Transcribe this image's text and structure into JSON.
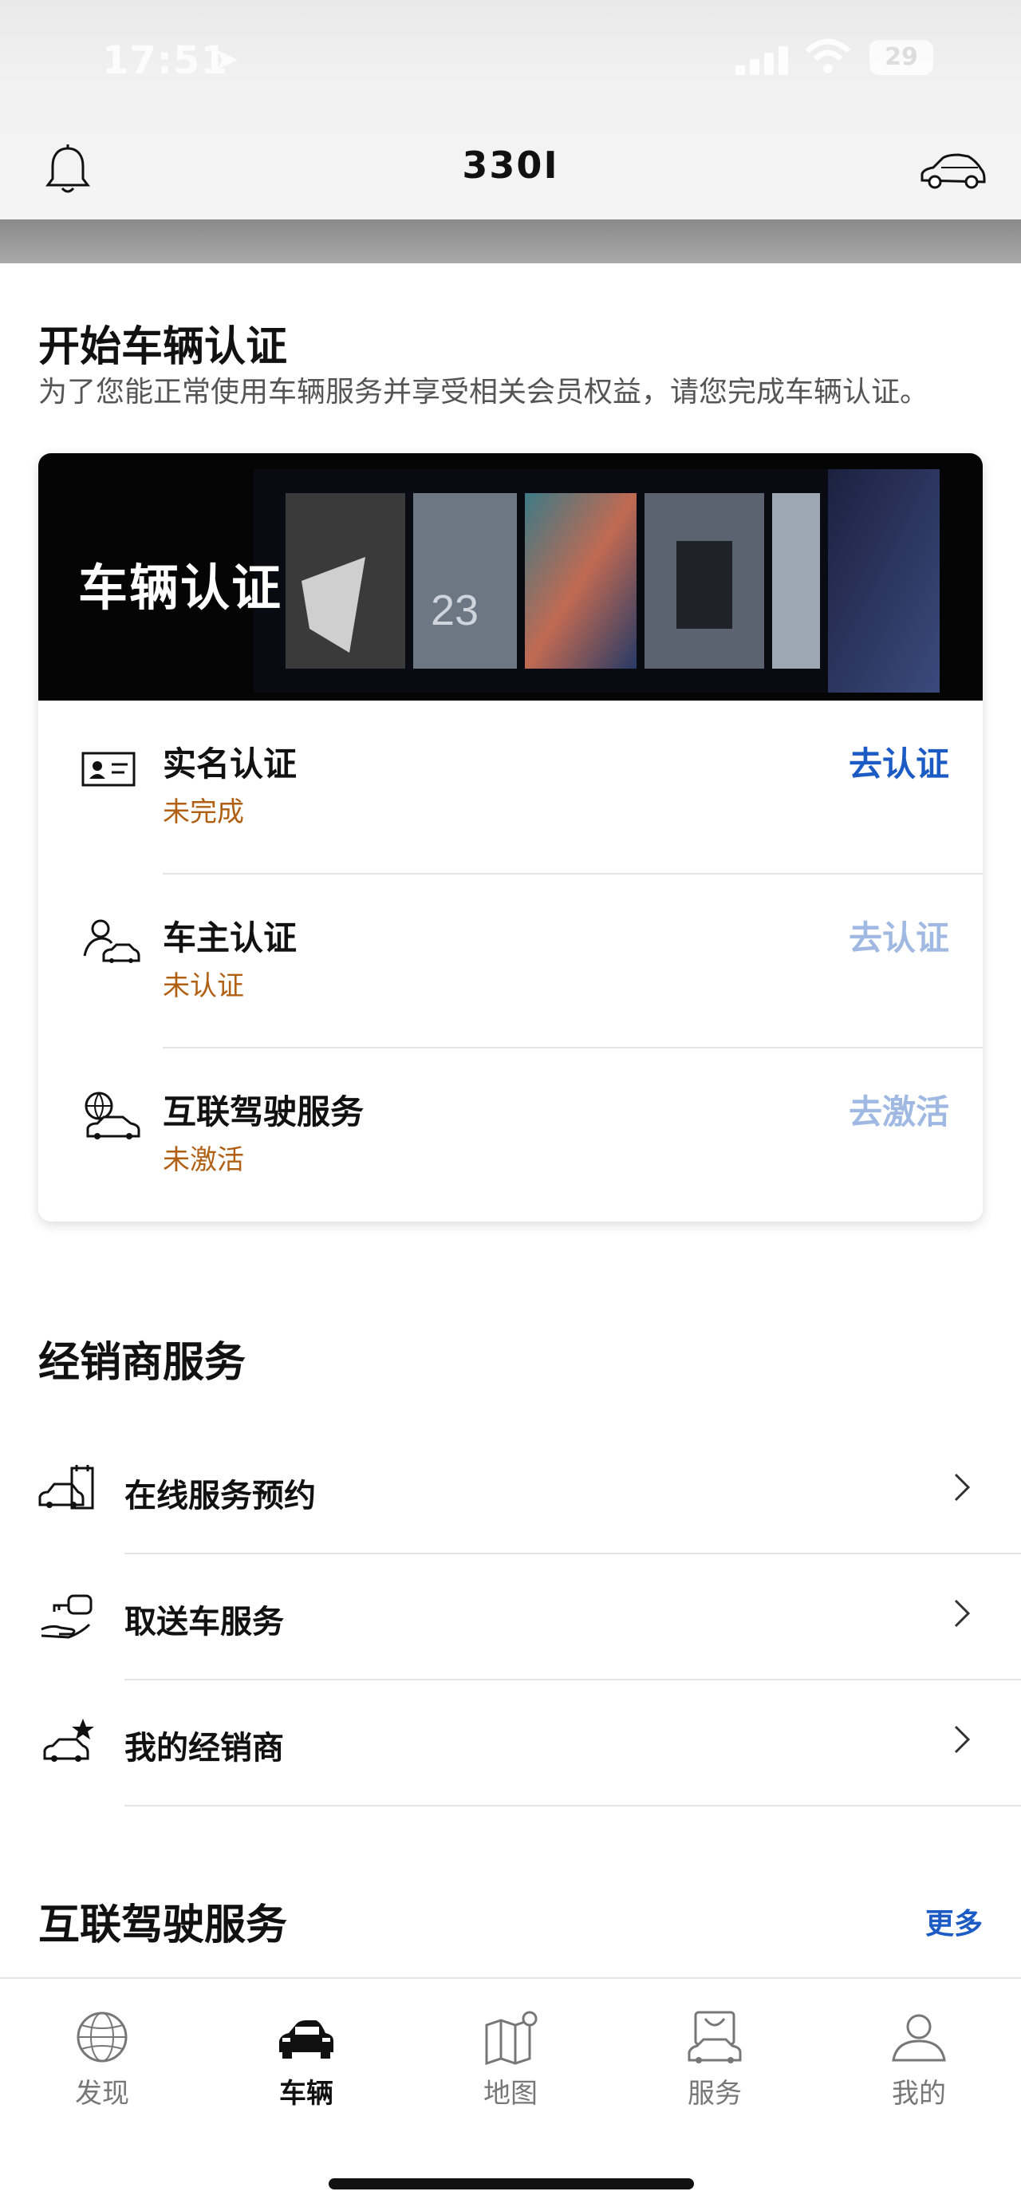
{
  "status_bar": {
    "time": "17:51",
    "battery": "29"
  },
  "header": {
    "title": "330I"
  },
  "verification": {
    "title": "开始车辆认证",
    "subtitle": "为了您能正常使用车辆服务并享受相关会员权益，请您完成车辆认证。",
    "banner_title": "车辆认证",
    "banner_screen_number": "23",
    "items": [
      {
        "label": "实名认证",
        "status": "未完成",
        "action": "去认证",
        "icon": "id-card-icon",
        "action_state": "active"
      },
      {
        "label": "车主认证",
        "status": "未认证",
        "action": "去认证",
        "icon": "owner-car-icon",
        "action_state": "disabled"
      },
      {
        "label": "互联驾驶服务",
        "status": "未激活",
        "action": "去激活",
        "icon": "connected-drive-icon",
        "action_state": "disabled"
      }
    ]
  },
  "dealer": {
    "title": "经销商服务",
    "items": [
      {
        "label": "在线服务预约",
        "icon": "service-appointment-icon"
      },
      {
        "label": "取送车服务",
        "icon": "car-pickup-key-icon"
      },
      {
        "label": "我的经销商",
        "icon": "favorite-dealer-car-icon"
      }
    ]
  },
  "connected_drive": {
    "title": "互联驾驶服务",
    "more_label": "更多"
  },
  "tabbar": {
    "items": [
      {
        "label": "发现",
        "icon": "globe-icon",
        "active": false
      },
      {
        "label": "车辆",
        "icon": "car-icon",
        "active": true
      },
      {
        "label": "地图",
        "icon": "map-icon",
        "active": false
      },
      {
        "label": "服务",
        "icon": "shopping-bag-car-icon",
        "active": false
      },
      {
        "label": "我的",
        "icon": "profile-icon",
        "active": false
      }
    ]
  },
  "colors": {
    "accent_blue": "#1c5bc4",
    "disabled_blue": "#9fb9e2",
    "status_orange": "#b15f12",
    "banner_background": "#050505"
  }
}
